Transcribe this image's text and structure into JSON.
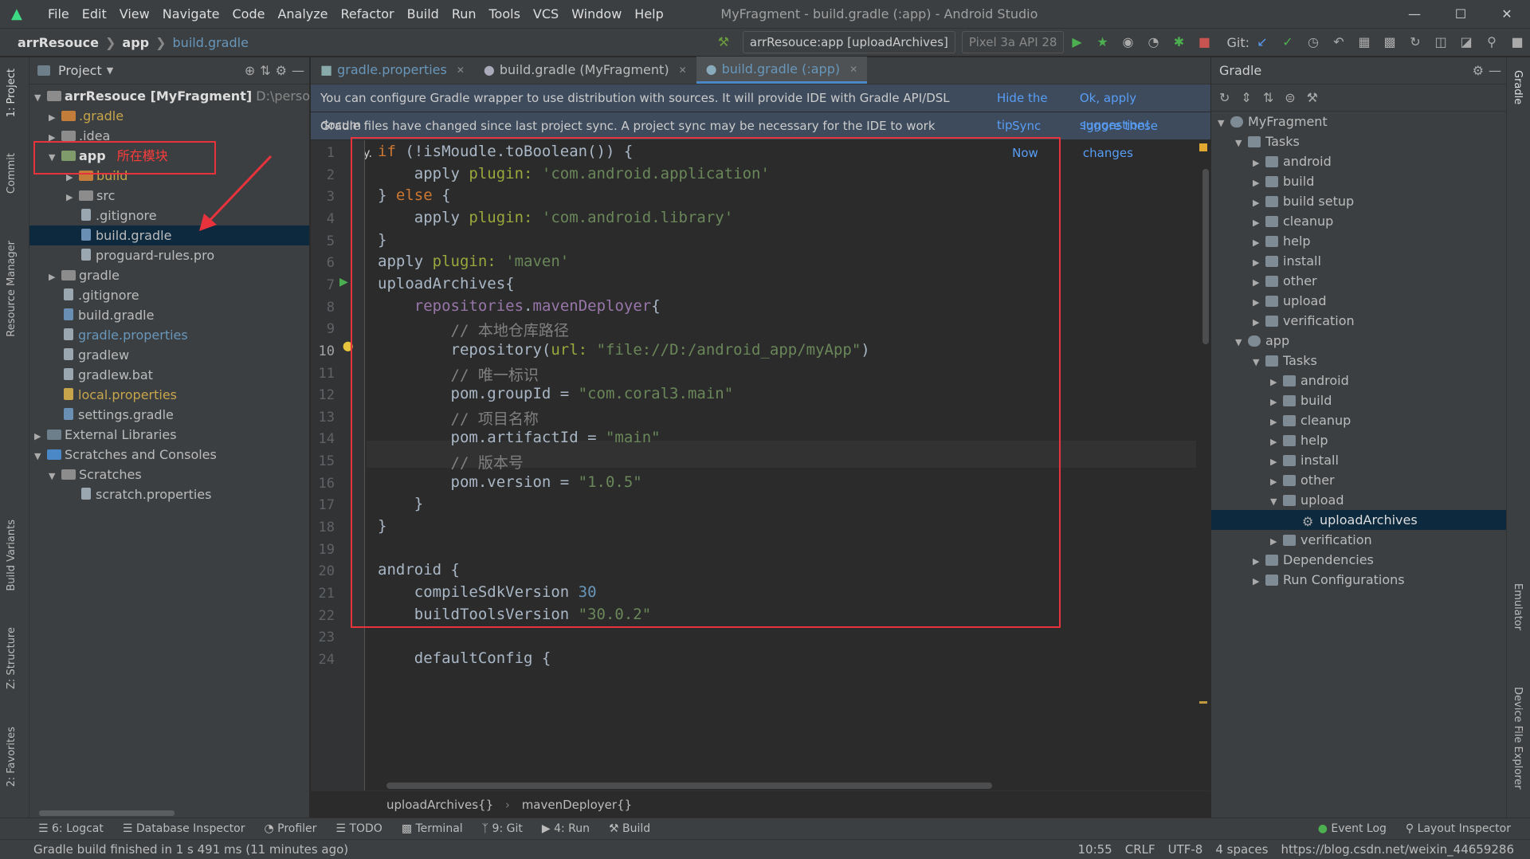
{
  "window": {
    "title": "MyFragment - build.gradle (:app) - Android Studio"
  },
  "menu": [
    "File",
    "Edit",
    "View",
    "Navigate",
    "Code",
    "Analyze",
    "Refactor",
    "Build",
    "Run",
    "Tools",
    "VCS",
    "Window",
    "Help"
  ],
  "breadcrumb": {
    "project": "arrResouce",
    "module": "app",
    "file": "build.gradle"
  },
  "toolbar": {
    "run_config": "arrResouce:app [uploadArchives]",
    "device": "Pixel 3a API 28",
    "git_label": "Git:"
  },
  "project_panel": {
    "title": "Project",
    "tree": [
      {
        "label": "arrResouce [MyFragment]",
        "extra": "D:\\personal\\ar"
      },
      {
        "label": ".gradle"
      },
      {
        "label": ".idea"
      },
      {
        "label": "app",
        "annotation": "所在模块"
      },
      {
        "label": "build"
      },
      {
        "label": "src"
      },
      {
        "label": ".gitignore"
      },
      {
        "label": "build.gradle"
      },
      {
        "label": "proguard-rules.pro"
      },
      {
        "label": "gradle"
      },
      {
        "label": ".gitignore"
      },
      {
        "label": "build.gradle"
      },
      {
        "label": "gradle.properties"
      },
      {
        "label": "gradlew"
      },
      {
        "label": "gradlew.bat"
      },
      {
        "label": "local.properties"
      },
      {
        "label": "settings.gradle"
      },
      {
        "label": "External Libraries"
      },
      {
        "label": "Scratches and Consoles"
      },
      {
        "label": "Scratches"
      },
      {
        "label": "scratch.properties"
      }
    ]
  },
  "tool_strips": {
    "left": [
      "1: Project",
      "Commit",
      "Resource Manager",
      "Build Variants",
      "Z: Structure",
      "2: Favorites"
    ],
    "right": [
      "Gradle",
      "Emulator",
      "Device File Explorer"
    ]
  },
  "tabs": [
    {
      "label": "gradle.properties"
    },
    {
      "label": "build.gradle (MyFragment)"
    },
    {
      "label": "build.gradle (:app)"
    }
  ],
  "banners": {
    "wrapper": {
      "text": "You can configure Gradle wrapper to use distribution with sources. It will provide IDE with Gradle API/DSL docum",
      "link1": "Hide the tip",
      "link2": "Ok, apply suggestion!"
    },
    "sync": {
      "text": "Gradle files have changed since last project sync. A project sync may be necessary for the IDE to work properly.",
      "link1": "Sync Now",
      "link2": "Ignore these changes"
    }
  },
  "code_lines": [
    "if (!isMoudle.toBoolean()) {",
    "    apply plugin: 'com.android.application'",
    "} else {",
    "    apply plugin: 'com.android.library'",
    "}",
    "apply plugin: 'maven'",
    "uploadArchives{",
    "    repositories.mavenDeployer{",
    "        // 本地仓库路径",
    "        repository(url: \"file://D:/android_app/myApp\")",
    "        // 唯一标识",
    "        pom.groupId = \"com.coral3.main\"",
    "        // 项目名称",
    "        pom.artifactId = \"main\"",
    "        // 版本号",
    "        pom.version = \"1.0.5\"",
    "    }",
    "}",
    "",
    "android {",
    "    compileSdkVersion 30",
    "    buildToolsVersion \"30.0.2\"",
    "",
    "    defaultConfig {"
  ],
  "editor_breadcrumb": [
    "uploadArchives{}",
    "mavenDeployer{}"
  ],
  "gradle_panel": {
    "title": "Gradle",
    "tree": [
      "MyFragment",
      "Tasks",
      "android",
      "build",
      "build setup",
      "cleanup",
      "help",
      "install",
      "other",
      "upload",
      "verification",
      "app",
      "Tasks",
      "android",
      "build",
      "cleanup",
      "help",
      "install",
      "other",
      "upload",
      "uploadArchives",
      "verification",
      "Dependencies",
      "Run Configurations"
    ]
  },
  "bottom_tools": [
    "6: Logcat",
    "Database Inspector",
    "Profiler",
    "TODO",
    "Terminal",
    "9: Git",
    "4: Run",
    "Build",
    "Event Log",
    "Layout Inspector"
  ],
  "status": {
    "message": "Gradle build finished in 1 s 491 ms (11 minutes ago)",
    "position": "10:55",
    "line_sep": "CRLF",
    "encoding": "UTF-8",
    "indent": "4 spaces",
    "watermark": "https://blog.csdn.net/weixin_44659286"
  }
}
